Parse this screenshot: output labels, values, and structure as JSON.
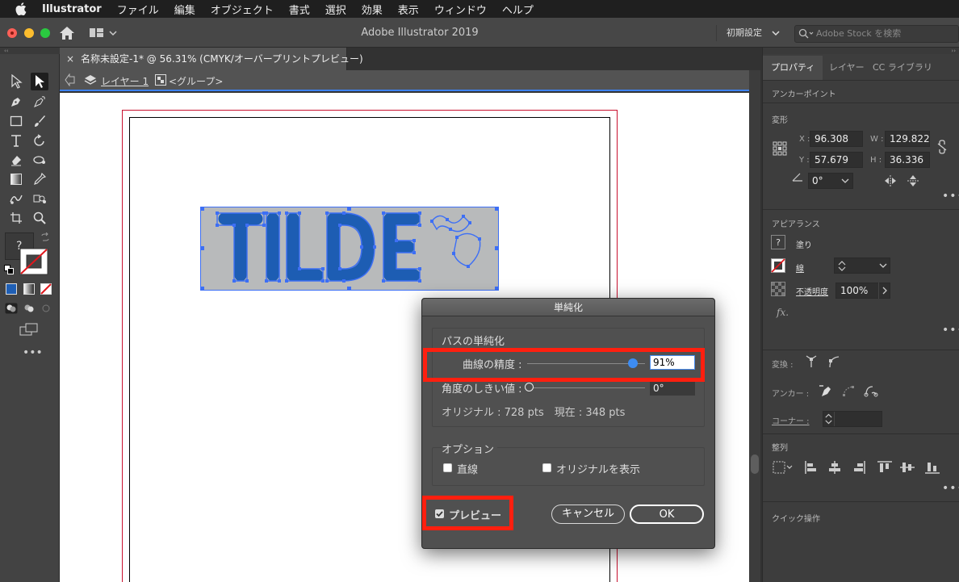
{
  "menubar": {
    "items": [
      "Illustrator",
      "ファイル",
      "編集",
      "オブジェクト",
      "書式",
      "選択",
      "効果",
      "表示",
      "ウィンドウ",
      "ヘルプ"
    ]
  },
  "titlebar": {
    "title": "Adobe Illustrator 2019",
    "preset": "初期設定",
    "stock_search_placeholder": "Adobe Stock を検索"
  },
  "document": {
    "tab_label": "名称未設定-1* @ 56.31% (CMYK/オーバープリントプレビュー)",
    "breadcrumb": [
      "レイヤー 1",
      "<グループ>"
    ],
    "artwork_text": "TILDE~"
  },
  "tools": {
    "fill_placeholder": "?"
  },
  "dialog": {
    "title": "単純化",
    "group_title": "パスの単純化",
    "curve_precision_label": "曲線の精度 :",
    "curve_precision_value": "91%",
    "curve_precision_fraction": 0.91,
    "angle_threshold_label": "角度のしきい値 :",
    "angle_threshold_value": "0°",
    "points_info": "オリジナル : 728 pts　現在 : 348 pts",
    "options_title": "オプション",
    "option_straight": "直線",
    "option_show_original": "オリジナルを表示",
    "preview_label": "プレビュー",
    "preview_checked": true,
    "cancel_label": "キャンセル",
    "ok_label": "OK"
  },
  "properties": {
    "tabs": [
      "プロパティ",
      "レイヤー",
      "CC ライブラリ"
    ],
    "selection_type": "アンカーポイント",
    "transform": {
      "title": "変形",
      "x_label": "X :",
      "x_value": "96.308",
      "y_label": "Y :",
      "y_value": "57.679",
      "w_label": "W :",
      "w_value": "129.822",
      "h_label": "H :",
      "h_value": "36.336",
      "angle_value": "0°"
    },
    "appearance": {
      "title": "アピアランス",
      "fill_label": "塗り",
      "stroke_label": "線",
      "opacity_label": "不透明度",
      "opacity_value": "100%",
      "fx_label": "fx."
    },
    "convert_label": "変換 :",
    "anchor_label": "アンカー :",
    "corner_label": "コーナー :",
    "align_title": "整列",
    "quick_actions_title": "クイック操作"
  },
  "colors": {
    "selection_blue": "#3d6ff5",
    "highlight_red": "#ff1f0f",
    "artboard_bleed": "#c8102e"
  }
}
